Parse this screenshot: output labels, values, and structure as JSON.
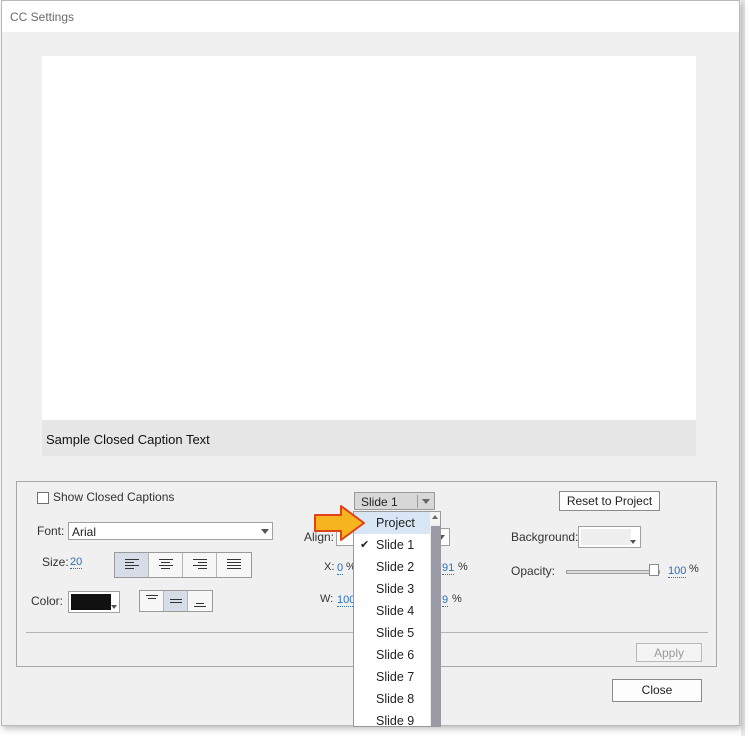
{
  "window": {
    "title": "CC Settings"
  },
  "preview": {
    "caption_text": "Sample Closed Caption Text"
  },
  "settings": {
    "show_cc_label": "Show Closed Captions",
    "font_label": "Font:",
    "font_value": "Arial",
    "size_label": "Size:",
    "size_value": "20",
    "color_label": "Color:",
    "color_value": "#111111",
    "align_label": "Align:",
    "x_label": "X:",
    "x_value": "0",
    "x_unit": "%",
    "y_value_partial": "91",
    "y_unit": "%",
    "w_label": "W:",
    "w_value_partial": "100",
    "h_value_partial": "9",
    "h_unit": "%",
    "background_label": "Background:",
    "opacity_label": "Opacity:",
    "opacity_value": "100",
    "opacity_unit": "%",
    "opacity_level": 1.0
  },
  "slide_select": {
    "selected": "Slide 1",
    "options": [
      "Project",
      "Slide 1",
      "Slide 2",
      "Slide 3",
      "Slide 4",
      "Slide 5",
      "Slide 6",
      "Slide 7",
      "Slide 8",
      "Slide 9"
    ],
    "highlighted": "Project",
    "checked": "Slide 1"
  },
  "buttons": {
    "reset": "Reset to Project",
    "apply": "Apply",
    "close": "Close"
  },
  "colors": {
    "pointer_fill": "#f4b400",
    "pointer_stroke": "#e0401a",
    "highlight": "#d8e6f5"
  }
}
